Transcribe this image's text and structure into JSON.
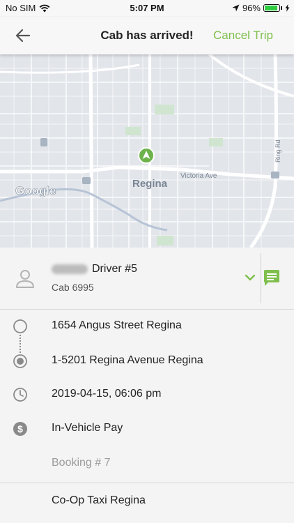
{
  "status_bar": {
    "carrier": "No SIM",
    "time": "5:07 PM",
    "battery": "96%",
    "battery_level": 0.96
  },
  "nav": {
    "title": "Cab has arrived!",
    "cancel_label": "Cancel Trip"
  },
  "map": {
    "city_label": "Regina",
    "street_label_1": "Victoria Ave",
    "street_label_2": "Ring Rd",
    "provider": "Google"
  },
  "driver": {
    "name": "Driver #5",
    "cab": "Cab 6995"
  },
  "trip": {
    "pickup": "1654 Angus Street Regina",
    "dropoff": "1-5201 Regina Avenue Regina",
    "datetime": "2019-04-15, 06:06 pm",
    "payment": "In-Vehicle Pay",
    "booking": "Booking # 7",
    "company": "Co-Op Taxi Regina"
  },
  "colors": {
    "accent": "#7fbf4d"
  }
}
